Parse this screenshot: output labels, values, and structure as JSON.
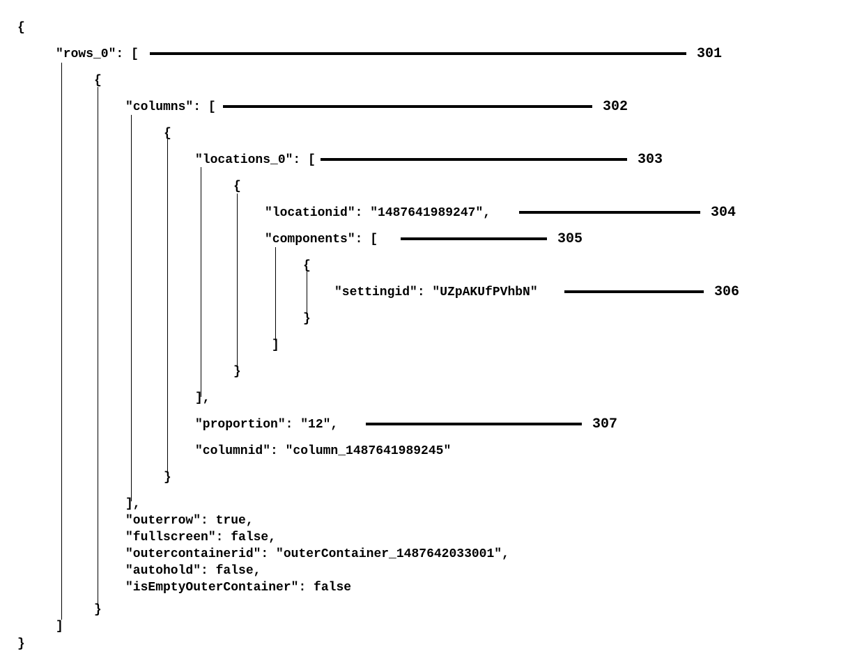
{
  "code": {
    "line1": "{",
    "line2": "\"rows_0\": [",
    "line3": "{",
    "line4": "\"columns\": [",
    "line5": "{",
    "line6": "\"locations_0\": [",
    "line7": "{",
    "line8": "\"locationid\": \"1487641989247\",",
    "line9": "\"components\": [",
    "line10": "{",
    "line11": "\"settingid\": \"UZpAKUfPVhbN\"",
    "line12": "}",
    "line13": "]",
    "line14": "}",
    "line15": "],",
    "line16": "\"proportion\": \"12\",",
    "line17": "\"columnid\": \"column_1487641989245\"",
    "line18": "}",
    "line19": "],",
    "line20": "\"outerrow\": true,",
    "line21": "\"fullscreen\": false,",
    "line22": "\"outercontainerid\": \"outerContainer_1487642033001\",",
    "line23": "\"autohold\": false,",
    "line24": "\"isEmptyOuterContainer\": false",
    "line25": "}",
    "line26": "]",
    "line27": "}"
  },
  "callouts": {
    "n301": "301",
    "n302": "302",
    "n303": "303",
    "n304": "304",
    "n305": "305",
    "n306": "306",
    "n307": "307"
  }
}
